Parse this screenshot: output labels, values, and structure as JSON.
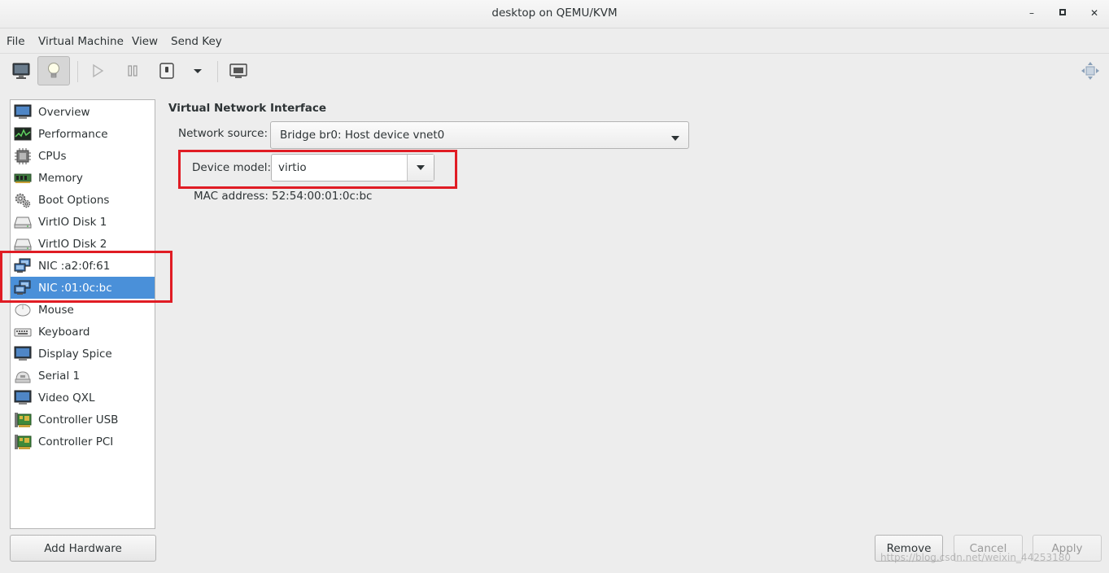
{
  "window": {
    "title": "desktop on QEMU/KVM",
    "minimize_icon": "minimize-icon",
    "maximize_icon": "maximize-icon",
    "close_icon": "close-icon"
  },
  "menu": [
    "File",
    "Virtual Machine",
    "View",
    "Send Key"
  ],
  "toolbar": {
    "buttons": [
      "console-icon",
      "details-lightbulb-icon",
      "run-icon",
      "pause-icon",
      "shutdown-icon",
      "shutdown-menu-chevron-icon",
      "snapshots-icon",
      "fullscreen-icon"
    ]
  },
  "hardware_list": [
    {
      "label": "Overview",
      "icon": "monitor-icon"
    },
    {
      "label": "Performance",
      "icon": "performance-graph-icon"
    },
    {
      "label": "CPUs",
      "icon": "cpu-icon"
    },
    {
      "label": "Memory",
      "icon": "memory-icon"
    },
    {
      "label": "Boot Options",
      "icon": "gears-icon"
    },
    {
      "label": "VirtIO Disk 1",
      "icon": "disk-icon"
    },
    {
      "label": "VirtIO Disk 2",
      "icon": "disk-icon"
    },
    {
      "label": "NIC :a2:0f:61",
      "icon": "network-icon"
    },
    {
      "label": "NIC :01:0c:bc",
      "icon": "network-icon",
      "selected": true
    },
    {
      "label": "Mouse",
      "icon": "mouse-icon"
    },
    {
      "label": "Keyboard",
      "icon": "keyboard-icon"
    },
    {
      "label": "Display Spice",
      "icon": "display-icon"
    },
    {
      "label": "Serial 1",
      "icon": "serial-icon"
    },
    {
      "label": "Video QXL",
      "icon": "video-icon"
    },
    {
      "label": "Controller USB",
      "icon": "controller-icon"
    },
    {
      "label": "Controller PCI",
      "icon": "controller-icon"
    }
  ],
  "add_hardware_label": "Add Hardware",
  "details": {
    "section_title": "Virtual Network Interface",
    "network_source_label": "Network source:",
    "network_source_value": "Bridge br0: Host device vnet0",
    "device_model_label": "Device model:",
    "device_model_value": "virtio",
    "mac_label": "MAC address:",
    "mac_value": "52:54:00:01:0c:bc"
  },
  "buttons": {
    "remove": "Remove",
    "cancel": "Cancel",
    "apply": "Apply"
  },
  "watermark": "https://blog.csdn.net/weixin_44253180",
  "colors": {
    "selection": "#4a90d9",
    "highlight_box": "#e01c24",
    "background": "#ededed"
  }
}
